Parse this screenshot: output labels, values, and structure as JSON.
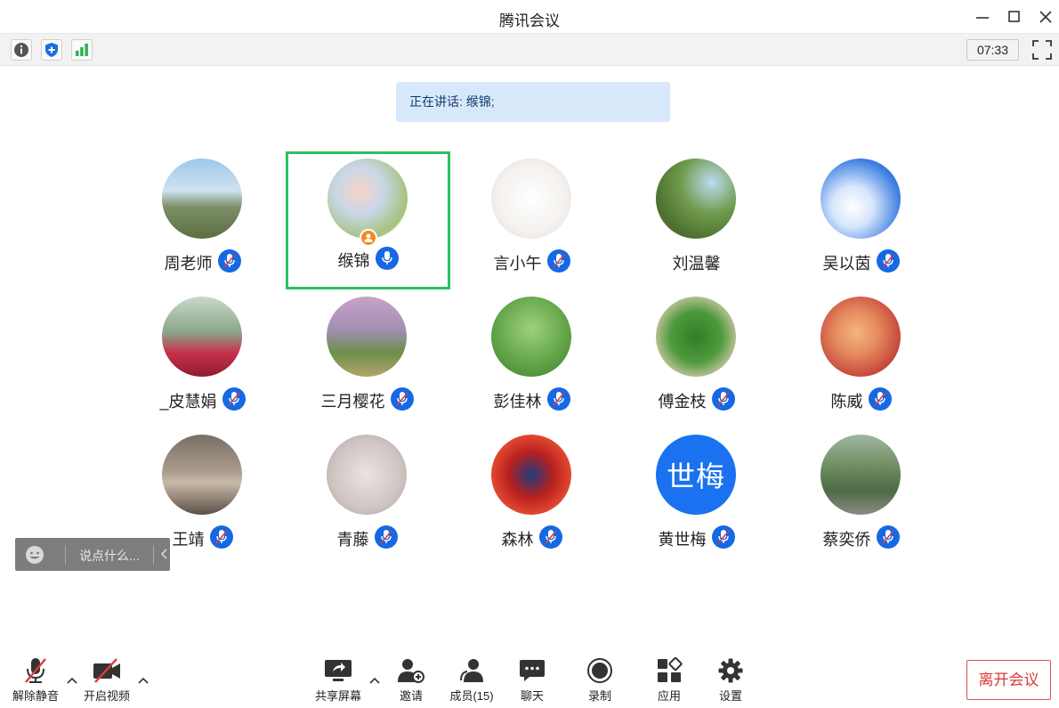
{
  "window": {
    "title": "腾讯会议"
  },
  "status": {
    "timer": "07:33"
  },
  "speaking": {
    "text": "正在讲话: 缑锦;"
  },
  "participants": [
    {
      "name": "周老师"
    },
    {
      "name": "缑锦"
    },
    {
      "name": "言小午"
    },
    {
      "name": "刘温馨"
    },
    {
      "name": "吴以茵"
    },
    {
      "name": "_皮慧娟"
    },
    {
      "name": "三月樱花"
    },
    {
      "name": "彭佳林"
    },
    {
      "name": "傅金枝"
    },
    {
      "name": "陈威"
    },
    {
      "name": "王靖"
    },
    {
      "name": "青藤"
    },
    {
      "name": "森林"
    },
    {
      "name": "黄世梅",
      "avatar_text": "世梅"
    },
    {
      "name": "蔡奕侨"
    }
  ],
  "chat": {
    "placeholder": "说点什么..."
  },
  "toolbar": {
    "unmute": "解除静音",
    "start_video": "开启视频",
    "share_screen": "共享屏幕",
    "invite": "邀请",
    "members": "成员(15)",
    "chat": "聊天",
    "record": "录制",
    "apps": "应用",
    "settings": "设置",
    "leave": "离开会议"
  },
  "colors": {
    "accent": "#1668e3",
    "active_border": "#2fbf64",
    "leave": "#d9383a"
  }
}
